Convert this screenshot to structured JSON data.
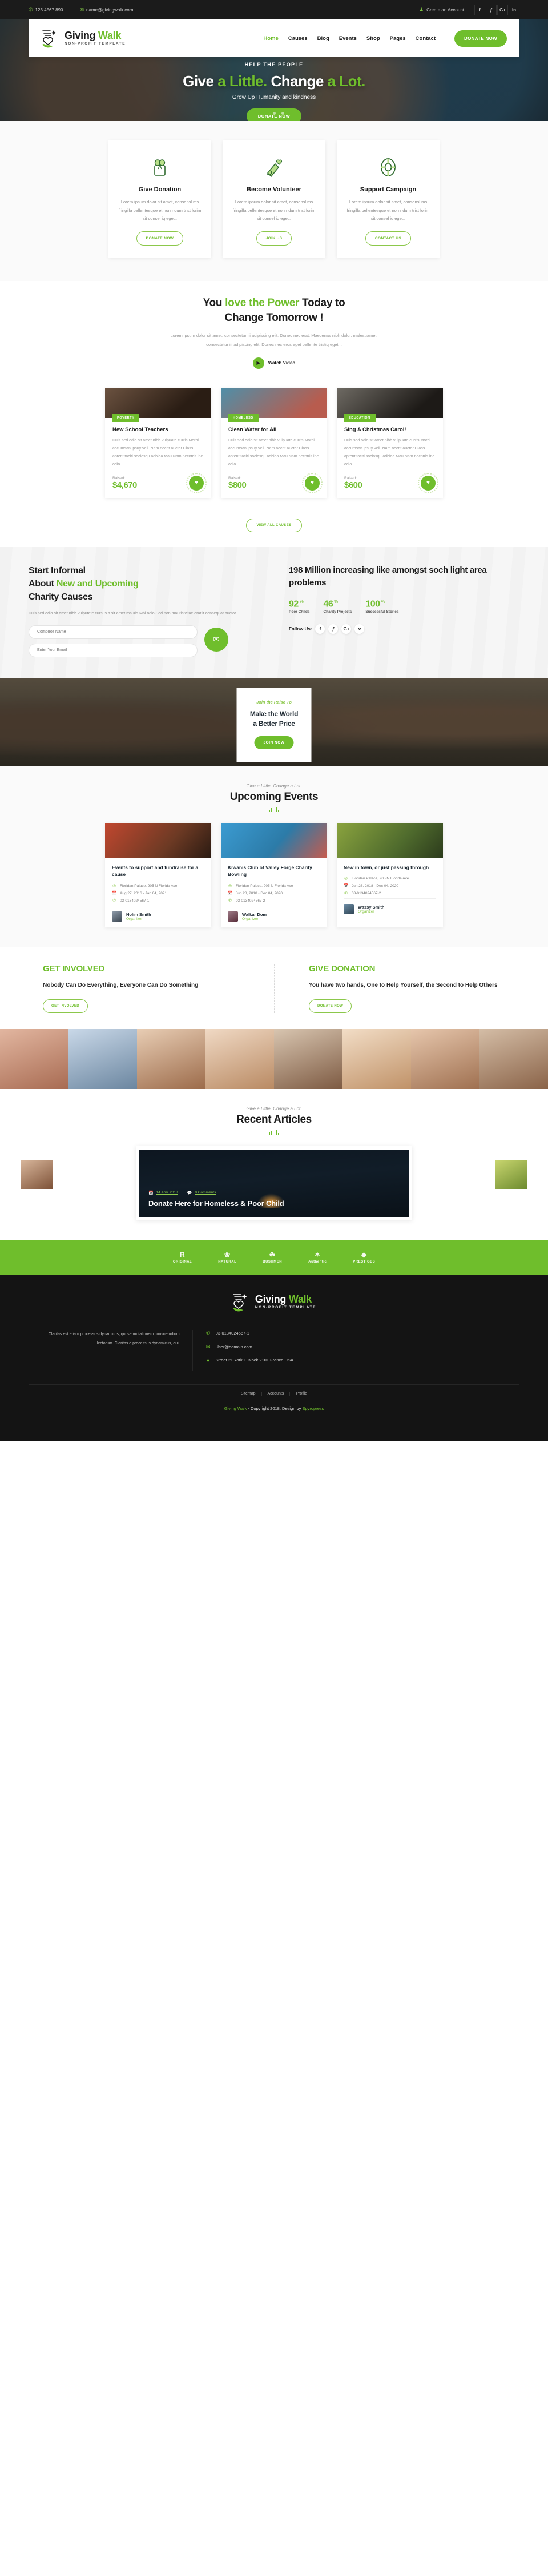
{
  "topbar": {
    "phone": "123 4567 890",
    "email": "name@givingwalk.com",
    "account": "Create an Account",
    "phone_icon": "phone-icon",
    "email_icon": "envelope-icon",
    "account_icon": "user-icon",
    "socials": [
      "f",
      "ƒ",
      "G+",
      "in"
    ]
  },
  "brand": {
    "name_first": "Giving",
    "name_second": "Walk",
    "tagline": "NON-PROFIT TEMPLATE"
  },
  "nav": {
    "items": [
      {
        "label": "Home",
        "active": true
      },
      {
        "label": "Causes",
        "active": false
      },
      {
        "label": "Blog",
        "active": false
      },
      {
        "label": "Events",
        "active": false
      },
      {
        "label": "Shop",
        "active": false
      },
      {
        "label": "Pages",
        "active": false
      },
      {
        "label": "Contact",
        "active": false
      }
    ],
    "donate": "DONATE NOW"
  },
  "hero": {
    "kicker": "HELP THE PEOPLE",
    "title_a": "Give",
    "title_b": "a Little.",
    "title_c": "Change",
    "title_d": "a Lot.",
    "subtitle": "Grow Up Humanity and kindness",
    "cta": "DONATE NOW"
  },
  "services": [
    {
      "icon": "gift-icon",
      "title": "Give Donation",
      "text": "Lorem ipsum dolor sit amet, consensl ms fringilla pellentesque et non ndum trist lorim sit consel iq eget..",
      "cta": "DONATE NOW"
    },
    {
      "icon": "megaphone-icon",
      "title": "Become Volunteer",
      "text": "Lorem ipsum dolor sit amet, consensl ms fringilla pellentesque et non ndum trist lorim sit consel iq eget..",
      "cta": "JOIN US"
    },
    {
      "icon": "lifebuoy-icon",
      "title": "Support Campaign",
      "text": "Lorem ipsum dolor sit amet, consensl ms fringilla pellentesque et non ndum trist lorim sit consel iq eget..",
      "cta": "CONTACT US"
    }
  ],
  "power": {
    "title_a": "You",
    "title_b": "love the Power",
    "title_c": "Today to",
    "title_d": "Change Tomorrow !",
    "text": "Lorem ipsum dolor sit amet, consectetur ili adipiscing elit. Donec nec erat. Maecenas nibh dolor, malesuamet, consectetur ili adipiscing elit. Donec nec eros eget pellente tristiq eget...",
    "watch": "Watch Video"
  },
  "causes": {
    "items": [
      {
        "tag": "POVERTY",
        "title": "New School Teachers",
        "text": "Duis sed odio sit amet nibh vulpuate curris Morbi accumsan ipsuy veli. Nam necnt auctor Class aptent taciti sociosqu adbiea Mau Nam necntris ine odio.",
        "raised_label": "Raised:",
        "raised": "$4,670"
      },
      {
        "tag": "HOMELESS",
        "title": "Clean Water for All",
        "text": "Duis sed odio sit amet nibh vulpuate curris Morbi accumsan ipsuy veli. Nam necnt auctor Class aptent taciti sociosqu adbiea Mau Nam necntris ine odio.",
        "raised_label": "Raised:",
        "raised": "$800"
      },
      {
        "tag": "EDUCATION",
        "title": "Sing A Christmas Carol!",
        "text": "Duis sed odio sit amet nibh vulpuate curris Morbi accumsan ipsuy veli. Nam necnt auctor Class aptent taciti sociosqu adbiea Mau Nam necntris ine odio.",
        "raised_label": "Raised:",
        "raised": "$600"
      }
    ],
    "view_all": "VIEW ALL CAUSES"
  },
  "informal": {
    "title_a": "Start Informal",
    "title_b": "About",
    "title_green": "New and Upcoming",
    "title_c": "Charity Causes",
    "text": "Duis sed odio sit amet nibh vulputate cursus a sit amet mauris Mbi odio Sed non mauris vitae erat it consequat auctor.",
    "name_placeholder": "Complete Name",
    "email_placeholder": "Enter Your Email",
    "send_icon": "envelope-icon",
    "right_title": "198 Million increasing like amongst soch light area problems",
    "stats": [
      {
        "num": "92",
        "unit": "%",
        "label": "Poor Childs"
      },
      {
        "num": "46",
        "unit": "%",
        "label": "Charity Projects"
      },
      {
        "num": "100",
        "unit": "%",
        "label": "Successful Stories"
      }
    ],
    "follow_label": "Follow Us:",
    "follow_socials": [
      "f",
      "ƒ",
      "G+",
      "v"
    ]
  },
  "race": {
    "kicker": "Join the Raise To",
    "title_a": "Make the World",
    "title_b": "a Better Price",
    "cta": "JOIN NOW"
  },
  "events": {
    "kicker": "Give a Little. Change a Lot.",
    "title": "Upcoming Events",
    "items": [
      {
        "title": "Events to support and fundraise for a cause",
        "location": "Floridan Palace, 905 N Florida Ave",
        "date": "Aug 27, 2016 - Jan 04, 2021",
        "phone": "03-0134024567-1",
        "organizer": "Nolim Smith",
        "role": "Organizer"
      },
      {
        "title": "Kiwanis Club of Valley Forge Charity Bowling",
        "location": "Floridan Palace, 905 N Florida Ave",
        "date": "Jun 28, 2018 - Dec 04, 2020",
        "phone": "03-0134024567-2",
        "organizer": "Walkar Dom",
        "role": "Organizer"
      },
      {
        "title": "New in town, or just passing through",
        "location": "Floridan Palace, 905 N Florida Ave",
        "date": "Jun 28, 2018 - Dec 04, 2020",
        "phone": "03-0134024567-2",
        "organizer": "Wassy Smith",
        "role": "Organizer"
      }
    ]
  },
  "involved": [
    {
      "heading": "GET INVOLVED",
      "text": "Nobody Can Do Everything, Everyone Can Do Something",
      "cta": "GET INVOLVED"
    },
    {
      "heading": "GIVE DONATION",
      "text": "You have two hands, One to Help Yourself, the Second to Help Others",
      "cta": "DONATE NOW"
    }
  ],
  "articles": {
    "kicker": "Give a Little. Change a Lot.",
    "title": "Recent Articles",
    "featured": {
      "date": "14 April 2018",
      "comments": "0 Comments",
      "title": "Donate Here for Homeless & Poor Child",
      "date_icon": "calendar-icon",
      "comment_icon": "comment-icon"
    }
  },
  "brands": [
    {
      "big": "R",
      "small": "ORIGINAL"
    },
    {
      "big": "❀",
      "small": "NATURAL"
    },
    {
      "big": "☘",
      "small": "BUSHMEN"
    },
    {
      "big": "✶",
      "small": "Authentic"
    },
    {
      "big": "◆",
      "small": "PRESTIGES"
    }
  ],
  "footer": {
    "about": "Claritas est etiam processus dynamicus, qui se mutationem consuetudium lectorum. Claritas e processus dynamicus, qui.",
    "contact": [
      {
        "icon": "phone-icon",
        "value": "03-0134024567-1"
      },
      {
        "icon": "envelope-icon",
        "value": "User@domain.com"
      },
      {
        "icon": "map-pin-icon",
        "value": "Street 21 York E Block 2101 France USA"
      }
    ],
    "links": [
      "Sitemap",
      "Accounts",
      "Profile"
    ],
    "copyright_brand": "Giving Walk",
    "copyright_mid": "- Copyright 2018. Design by",
    "copyright_author": "Spyropress"
  },
  "colors": {
    "accent": "#6fbe2c",
    "accent_light": "#8cc84b",
    "dark": "#1b1b1b"
  }
}
